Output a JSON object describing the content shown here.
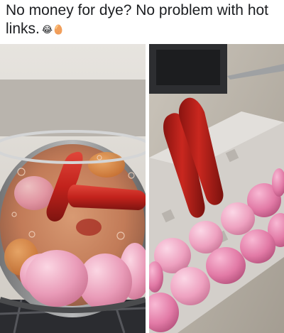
{
  "post": {
    "caption_text": "No money for dye? No problem with hot links.",
    "caption_emoji": "😂🥚",
    "emoji_icons": [
      "laughing-face-icon",
      "egg-icon"
    ]
  },
  "photos": {
    "left": {
      "subject": "pot-of-boiling-water-with-hot-links-and-eggs"
    },
    "right": {
      "subject": "egg-carton-with-pink-eggs-and-hot-links"
    }
  },
  "colors": {
    "egg_pink": "#e99bb8",
    "egg_deep_pink": "#e27aa6",
    "hot_link_red": "#c2221c",
    "carton_gray": "#cfcbc5",
    "pot_steel": "#8d8e8f"
  }
}
